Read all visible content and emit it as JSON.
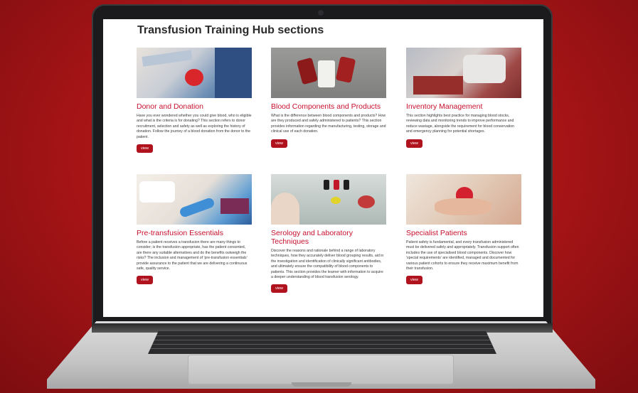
{
  "page": {
    "title": "Transfusion Training Hub sections"
  },
  "sections": [
    {
      "title": "Donor and Donation",
      "text": "Have you ever wondered whether you could give blood, who is eligible and what is the criteria is for donating? This section refers to donor recruitment, selection and safety as well as exploring the history of donation. Follow the journey of a blood donation from the donor to the patient.",
      "button": "view"
    },
    {
      "title": "Blood Components and Products",
      "text": "What is the difference between blood components and products? How are they produced and safely administered to patients? This section provides information regarding the manufacturing, testing, storage and clinical use of each donation.",
      "button": "view"
    },
    {
      "title": "Inventory Management",
      "text": "This section highlights best practice for managing blood stocks, reviewing data and monitoring trends to improve performance and reduce wastage, alongside the requirement for blood conservation and emergency planning for potential shortages.",
      "button": "view"
    },
    {
      "title": "Pre-transfusion Essentials",
      "text": "Before a patient receives a transfusion there are many things to consider; is the transfusion appropriate, has the patient consented, are there any suitable alternatives and do the benefits outweigh the risks? The inclusion and management of 'pre-transfusion essentials' provide assurance to the patient that we are delivering a continuous safe, quality service.",
      "button": "view"
    },
    {
      "title": "Serology and Laboratory Techniques",
      "text": "Discover the reasons and rationale behind a range of laboratory techniques, how they accurately deliver blood grouping results, aid in the investigation and identification of clinically significant antibodies, and ultimately ensure the compatibility of blood components to patients. This section provides the learner with information to acquire a deeper understanding of blood transfusion serology.",
      "button": "view"
    },
    {
      "title": "Specialist Patients",
      "text": "Patient safety is fundamental, and every transfusion administered must be delivered safely and appropriately. Transfusion support often includes the use of specialised blood components. Discover how 'special requirements' are identified, managed and documented for various patient cohorts to ensure they receive maximum benefit from their transfusion.",
      "button": "view"
    }
  ],
  "colors": {
    "accent": "#c8102e",
    "button": "#b0131d",
    "background": "#a51416"
  }
}
